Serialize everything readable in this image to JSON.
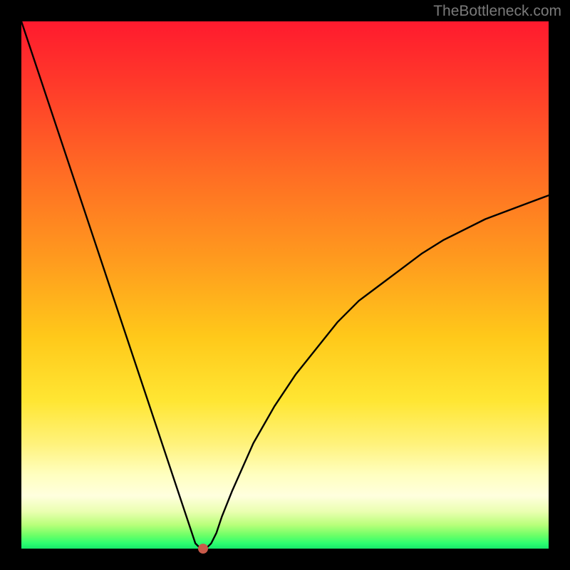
{
  "watermark": "TheBottleneck.com",
  "chart_data": {
    "type": "line",
    "title": "",
    "xlabel": "",
    "ylabel": "",
    "xlim": [
      0,
      100
    ],
    "ylim": [
      0,
      100
    ],
    "grid": false,
    "legend": false,
    "series": [
      {
        "name": "bottleneck-curve",
        "x": [
          0,
          4,
          8,
          12,
          16,
          20,
          24,
          28,
          30,
          32,
          33,
          34,
          35,
          36,
          37,
          38,
          40,
          44,
          48,
          52,
          56,
          60,
          64,
          68,
          72,
          76,
          80,
          84,
          88,
          92,
          96,
          100
        ],
        "values": [
          100,
          88,
          76,
          64,
          52,
          40,
          28,
          16,
          10,
          4,
          1,
          0,
          0,
          1,
          3,
          6,
          11,
          20,
          27,
          33,
          38,
          43,
          47,
          50,
          53,
          56,
          58.5,
          60.5,
          62.5,
          64,
          65.5,
          67
        ]
      }
    ],
    "annotations": [
      {
        "name": "minimum-marker",
        "x": 34.5,
        "y": 0
      }
    ],
    "background_gradient": {
      "top_color": "#ff1a2e",
      "bottom_color": "#17e86a",
      "stops": [
        "red",
        "orange",
        "yellow",
        "pale-yellow",
        "green"
      ]
    }
  }
}
